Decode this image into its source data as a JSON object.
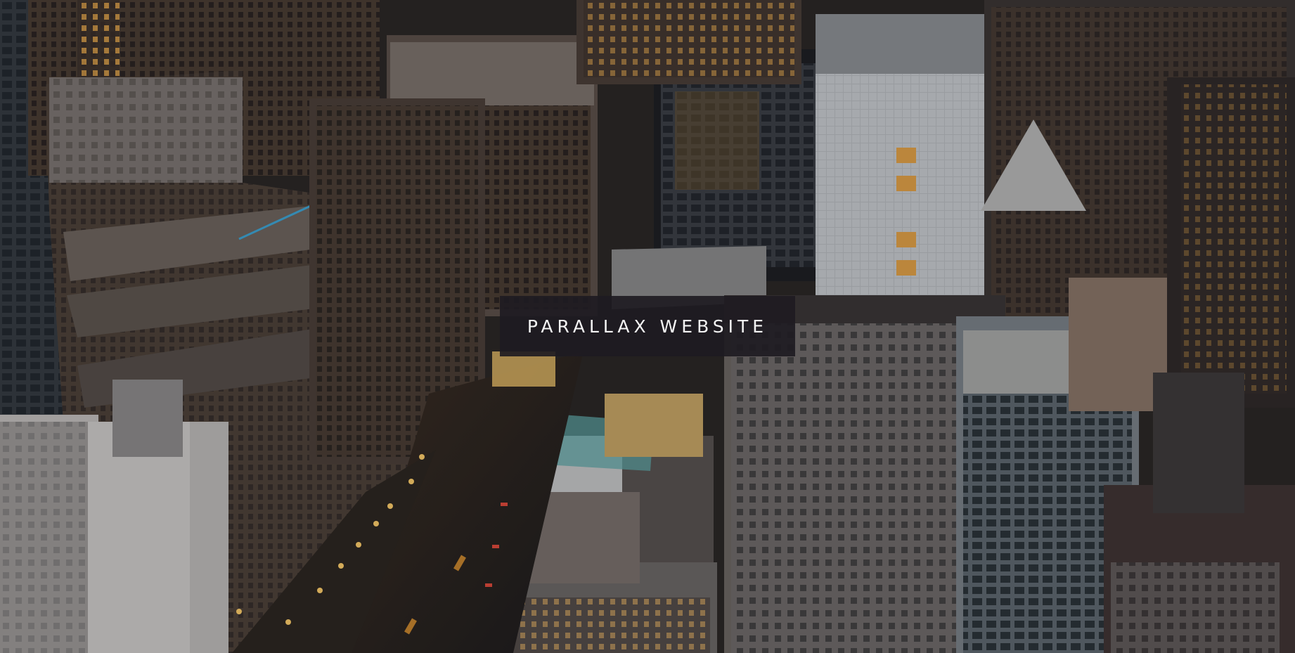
{
  "hero": {
    "title": "PARALLAX WEBSITE",
    "background_image": "aerial-city-night-image"
  },
  "colors": {
    "title_box_bg": "#1e1b22",
    "title_text": "#f4f4f4",
    "window_light": "#f2b54a"
  }
}
